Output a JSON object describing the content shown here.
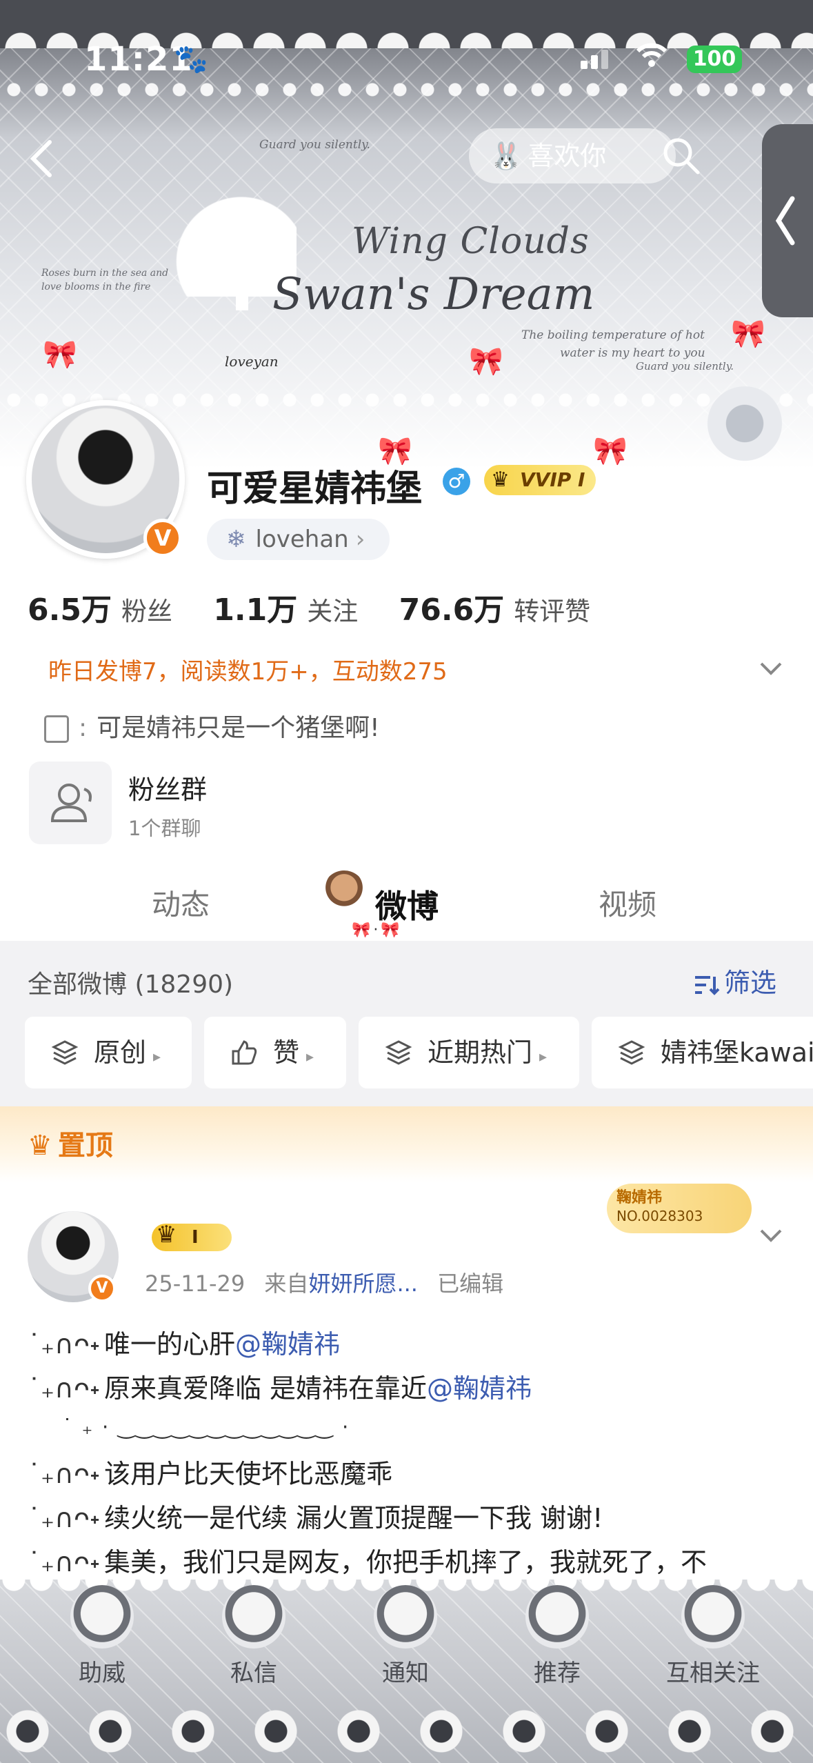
{
  "status_bar": {
    "time": "11:21",
    "battery": "100"
  },
  "header": {
    "like_label": "喜欢你"
  },
  "banner": {
    "brand_line1": "Wing Clouds",
    "brand_line2": "Swan's Dream",
    "script_top": "Guard you silently.",
    "script_left1": "Roses burn in the sea and",
    "script_left2": "love blooms in the fire",
    "script_right1": "The boiling temperature of hot",
    "script_right2": "water is my heart to you",
    "script_right3": "Guard you silently.",
    "signature": "loveyan"
  },
  "profile": {
    "name": "可爱星婧祎堡",
    "gender": "♂",
    "vip_label": "VVIP I",
    "verify_mark": "V",
    "handle": "lovehan",
    "stats": [
      {
        "value": "6.5万",
        "label": "粉丝"
      },
      {
        "value": "1.1万",
        "label": "关注"
      },
      {
        "value": "76.6万",
        "label": "转评赞"
      }
    ],
    "daily_summary": "昨日发博7，阅读数1万+，互动数275",
    "bio": "可是婧祎只是一个猪堡啊!",
    "fan_group": {
      "title": "粉丝群",
      "subtitle": "1个群聊"
    }
  },
  "tabs": [
    {
      "label": "动态",
      "active": false
    },
    {
      "label": "微博",
      "active": true
    },
    {
      "label": "视频",
      "active": false
    }
  ],
  "list_header": {
    "all_posts": "全部微博 (18290)",
    "filter_label": "筛选",
    "chips": [
      "原创",
      "赞",
      "近期热门",
      "婧祎堡kawai"
    ]
  },
  "pinned": {
    "label": "置顶",
    "fan_card": {
      "name": "鞠婧祎",
      "number": "NO.0028303"
    },
    "crown_level": "I",
    "date": "25-11-29",
    "from_prefix": "来自",
    "source": "妍妍所愿...",
    "edited": "已编辑",
    "deco": "˙₊∩ᴖ˖",
    "lines": [
      {
        "text": "唯一的心肝",
        "mention": "@鞠婧祎"
      },
      {
        "text": "原来真爱降临 是婧祎在靠近",
        "mention": "@鞠婧祎"
      },
      {
        "text": "该用户比天使坏比恶魔乖",
        "mention": ""
      },
      {
        "text": "续火统一是代续 漏火置顶提醒一下我 谢谢!",
        "mention": ""
      },
      {
        "text": "集美，我们只是网友，你把手机摔了，我就死了，不",
        "mention": ""
      }
    ],
    "deco_row": "˙ ₊ ·  ‿‿‿‿‿‿‿‿‿‿‿‿  ·"
  },
  "bottom_nav": [
    "助威",
    "私信",
    "通知",
    "推荐",
    "互相关注"
  ],
  "colors": {
    "accent_orange": "#e57916",
    "link_blue": "#3c5cb0",
    "verify_orange": "#f17d1c"
  }
}
